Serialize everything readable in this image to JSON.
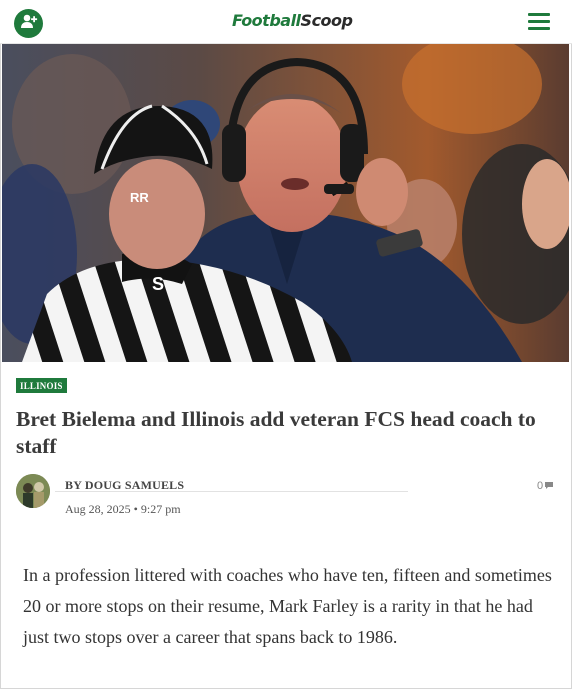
{
  "header": {
    "logo_part1": "Football",
    "logo_part2": "Scoop",
    "account_icon": "add-user-icon",
    "menu_icon": "hamburger-menu-icon"
  },
  "hero": {
    "cap_text": "RR",
    "jersey_letter": "S"
  },
  "article": {
    "category": "ILLINOIS",
    "title": "Bret Bielema and Illinois add veteran FCS head coach to staff",
    "author": "BY DOUG SAMUELS",
    "date": "Aug 28, 2025 • 9:27 pm",
    "comment_count": "0",
    "body": "In a profession littered with coaches who have ten, fifteen and sometimes 20 or more stops on their resume, Mark Farley is a rarity in that he had just two stops over a career that spans back to 1986."
  },
  "colors": {
    "brand_green": "#1f7a3c",
    "title_text": "#3a3a3a"
  }
}
